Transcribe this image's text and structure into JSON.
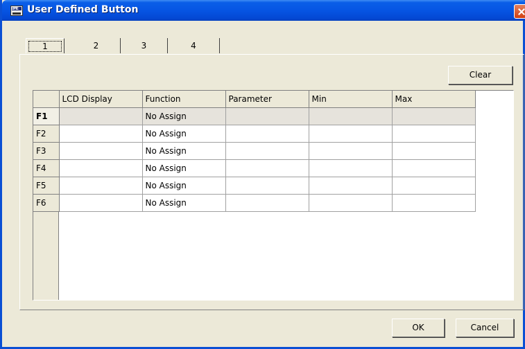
{
  "window": {
    "title": "User Defined Button",
    "icon": "dme-app-icon",
    "icon_text": "DME"
  },
  "tabs": [
    {
      "label": "1",
      "selected": true
    },
    {
      "label": "2",
      "selected": false
    },
    {
      "label": "3",
      "selected": false
    },
    {
      "label": "4",
      "selected": false
    }
  ],
  "toolbar": {
    "clear_label": "Clear"
  },
  "grid": {
    "columns": [
      "LCD Display",
      "Function",
      "Parameter",
      "Min",
      "Max"
    ],
    "rows": [
      {
        "key": "F1",
        "lcd": "",
        "function": "No Assign",
        "parameter": "",
        "min": "",
        "max": ""
      },
      {
        "key": "F2",
        "lcd": "",
        "function": "No Assign",
        "parameter": "",
        "min": "",
        "max": ""
      },
      {
        "key": "F3",
        "lcd": "",
        "function": "No Assign",
        "parameter": "",
        "min": "",
        "max": ""
      },
      {
        "key": "F4",
        "lcd": "",
        "function": "No Assign",
        "parameter": "",
        "min": "",
        "max": ""
      },
      {
        "key": "F5",
        "lcd": "",
        "function": "No Assign",
        "parameter": "",
        "min": "",
        "max": ""
      },
      {
        "key": "F6",
        "lcd": "",
        "function": "No Assign",
        "parameter": "",
        "min": "",
        "max": ""
      }
    ],
    "selected_row": "F1"
  },
  "footer": {
    "ok_label": "OK",
    "cancel_label": "Cancel"
  },
  "colors": {
    "titlebar": "#0655e3",
    "dialog_bg": "#ece9d8",
    "close_button": "#d23f12"
  }
}
